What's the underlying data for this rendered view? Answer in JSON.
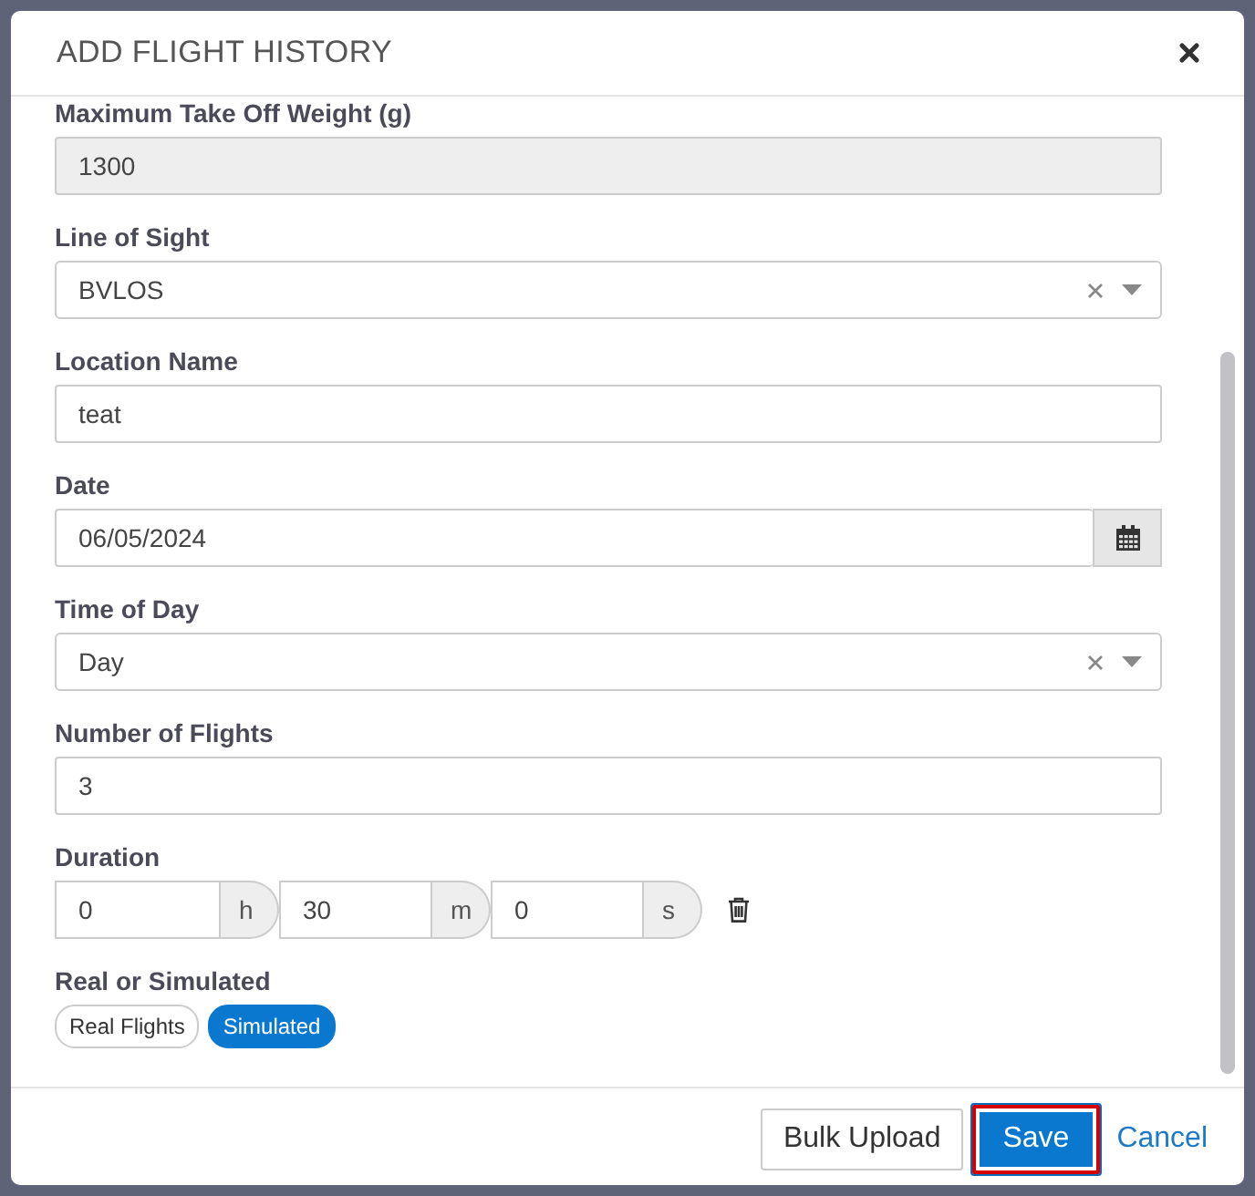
{
  "dialog": {
    "title": "ADD FLIGHT HISTORY"
  },
  "fields": [
    {
      "kind": "readonly",
      "label": "Maximum Take Off Weight (g)",
      "value": "1300"
    },
    {
      "kind": "select",
      "label": "Line of Sight",
      "value": "BVLOS"
    },
    {
      "kind": "text",
      "label": "Location Name",
      "value": "teat"
    },
    {
      "kind": "date",
      "label": "Date",
      "value": "06/05/2024"
    },
    {
      "kind": "select",
      "label": "Time of Day",
      "value": "Day"
    },
    {
      "kind": "text",
      "label": "Number of Flights",
      "value": "3"
    },
    {
      "kind": "duration",
      "label": "Duration",
      "parts": [
        {
          "value": "0",
          "unit": "h"
        },
        {
          "value": "30",
          "unit": "m"
        },
        {
          "value": "0",
          "unit": "s"
        }
      ]
    },
    {
      "kind": "toggle",
      "label": "Real or Simulated",
      "options": [
        {
          "label": "Real Flights",
          "selected": false
        },
        {
          "label": "Simulated",
          "selected": true
        }
      ]
    }
  ],
  "footer": {
    "buttons": [
      {
        "kind": "outline",
        "label": "Bulk Upload",
        "focused": false
      },
      {
        "kind": "primary",
        "label": "Save",
        "focused": true
      },
      {
        "kind": "link",
        "label": "Cancel",
        "focused": false
      }
    ]
  }
}
